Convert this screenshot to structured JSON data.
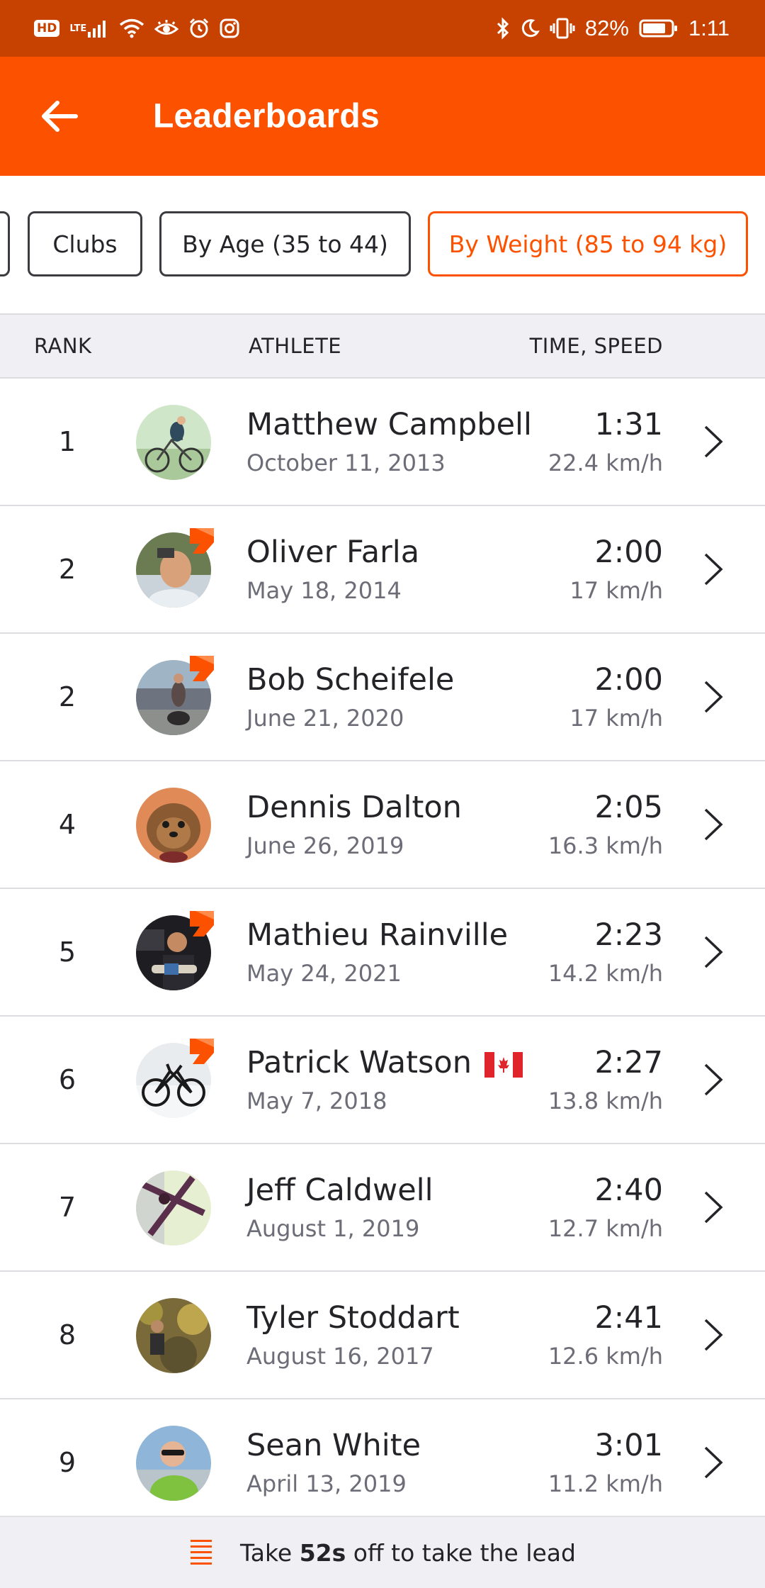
{
  "status_bar": {
    "hd": "HD",
    "lte": "LTE",
    "battery": "82%",
    "time": "1:11"
  },
  "header": {
    "title": "Leaderboards"
  },
  "filters": {
    "chips": [
      {
        "label": "Clubs",
        "active": false
      },
      {
        "label": "By Age (35 to 44)",
        "active": false
      },
      {
        "label": "By Weight (85 to 94 kg)",
        "active": true
      }
    ]
  },
  "table": {
    "columns": {
      "rank": "RANK",
      "athlete": "ATHLETE",
      "time_speed": "TIME, SPEED"
    },
    "rows": [
      {
        "rank": "1",
        "name": "Matthew Campbell",
        "date": "October 11, 2013",
        "time": "1:31",
        "speed": "22.4 km/h",
        "subscriber": false,
        "flag": ""
      },
      {
        "rank": "2",
        "name": "Oliver Farla",
        "date": "May 18, 2014",
        "time": "2:00",
        "speed": "17 km/h",
        "subscriber": true,
        "flag": ""
      },
      {
        "rank": "2",
        "name": "Bob Scheifele",
        "date": "June 21, 2020",
        "time": "2:00",
        "speed": "17 km/h",
        "subscriber": true,
        "flag": ""
      },
      {
        "rank": "4",
        "name": "Dennis Dalton",
        "date": "June 26, 2019",
        "time": "2:05",
        "speed": "16.3 km/h",
        "subscriber": false,
        "flag": ""
      },
      {
        "rank": "5",
        "name": "Mathieu Rainville",
        "date": "May 24, 2021",
        "time": "2:23",
        "speed": "14.2 km/h",
        "subscriber": true,
        "flag": ""
      },
      {
        "rank": "6",
        "name": "Patrick Watson",
        "date": "May 7, 2018",
        "time": "2:27",
        "speed": "13.8 km/h",
        "subscriber": true,
        "flag": "canada-flag-icon"
      },
      {
        "rank": "7",
        "name": "Jeff Caldwell",
        "date": "August 1, 2019",
        "time": "2:40",
        "speed": "12.7 km/h",
        "subscriber": false,
        "flag": ""
      },
      {
        "rank": "8",
        "name": "Tyler Stoddart",
        "date": "August 16, 2017",
        "time": "2:41",
        "speed": "12.6 km/h",
        "subscriber": false,
        "flag": ""
      },
      {
        "rank": "9",
        "name": "Sean White",
        "date": "April 13, 2019",
        "time": "3:01",
        "speed": "11.2 km/h",
        "subscriber": false,
        "flag": ""
      }
    ]
  },
  "banner": {
    "prefix": "Take ",
    "highlight": "52s",
    "suffix": " off to take the lead"
  },
  "colors": {
    "brand": "#fc5200",
    "status_bar": "#c74200",
    "header_bg": "#f0f0f4",
    "muted_text": "#6d6d78"
  }
}
